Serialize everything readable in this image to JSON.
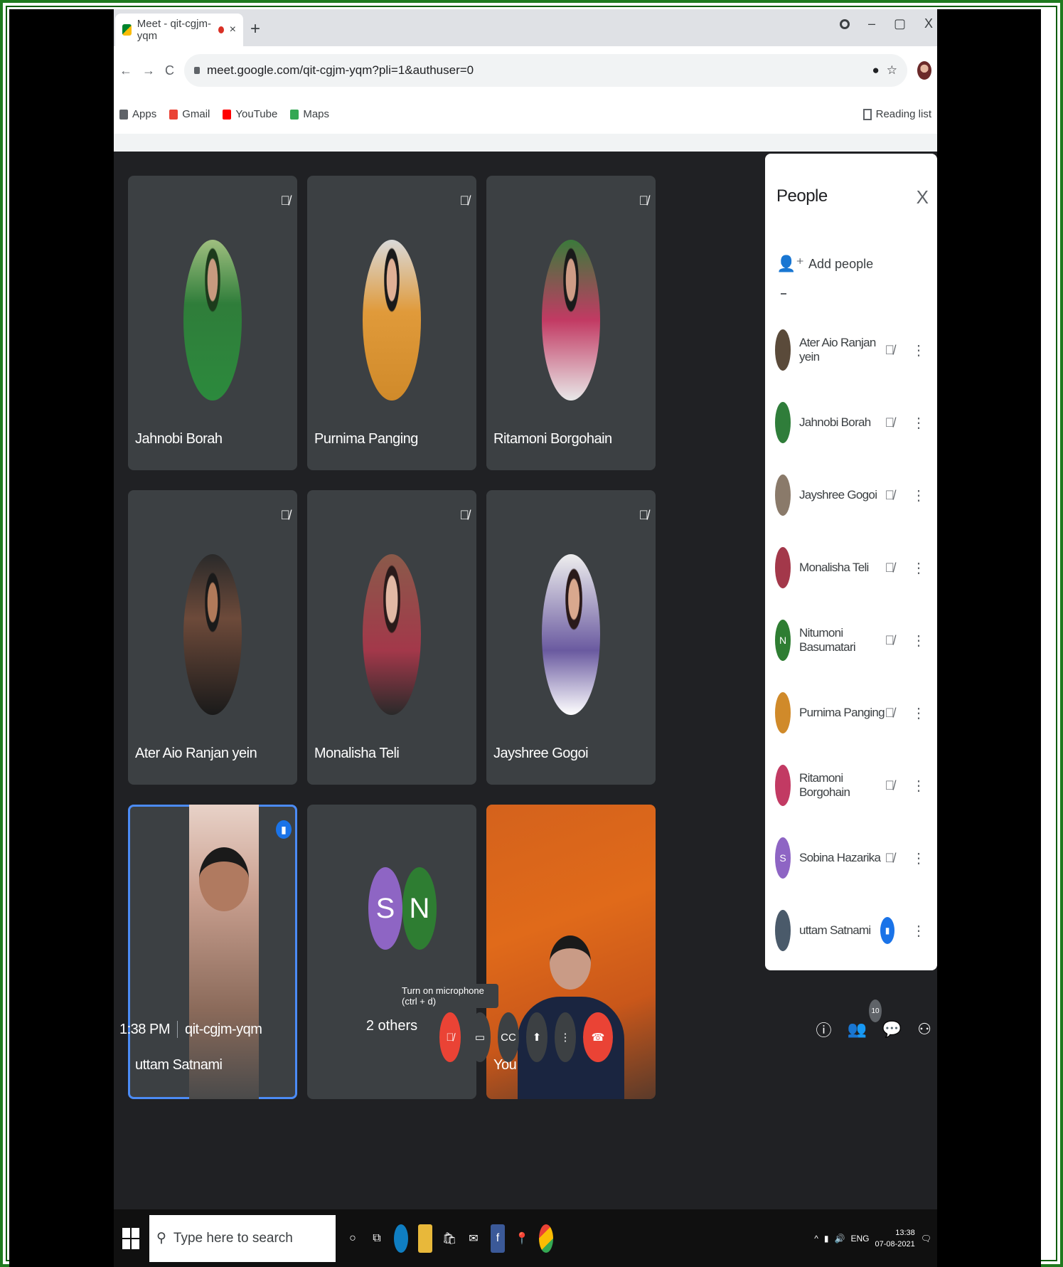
{
  "browser": {
    "tab_title": "Meet - qit-cgjm-yqm",
    "tab_close": "×",
    "new_tab": "+",
    "url": "meet.google.com/qit-cgjm-yqm?pli=1&authuser=0",
    "nav": {
      "back": "←",
      "forward": "→",
      "reload": "C"
    },
    "window_controls": {
      "minimize": "–",
      "maximize": "▢",
      "close": "X"
    },
    "bookmarks": [
      {
        "label": "Apps",
        "color": "#5f6368"
      },
      {
        "label": "Gmail",
        "color": "#ea4335"
      },
      {
        "label": "YouTube",
        "color": "#ff0000"
      },
      {
        "label": "Maps",
        "color": "#34a853"
      }
    ],
    "reading_list": "Reading list"
  },
  "tiles": [
    {
      "name": "Jahnobi Borah",
      "avatar": "av1"
    },
    {
      "name": "Purnima Panging",
      "avatar": "av2"
    },
    {
      "name": "Ritamoni Borgohain",
      "avatar": "av3"
    },
    {
      "name": "Ater Aio Ranjan yein",
      "avatar": "av4"
    },
    {
      "name": "Monalisha Teli",
      "avatar": "av5"
    },
    {
      "name": "Jayshree Gogoi",
      "avatar": "av6"
    }
  ],
  "video_tiles": {
    "uttam": "uttam Satnami",
    "others_label": "2 others",
    "others_initials": [
      "S",
      "N"
    ],
    "self": "You"
  },
  "people_panel": {
    "title": "People",
    "close": "X",
    "add_people": "Add people",
    "participants": [
      {
        "name": "Ater Aio Ranjan yein",
        "initial": "",
        "color": "#5a4a3a",
        "mic": "off"
      },
      {
        "name": "Jahnobi Borah",
        "initial": "",
        "color": "#2f7d3a",
        "mic": "off"
      },
      {
        "name": "Jayshree Gogoi",
        "initial": "",
        "color": "#8a7a6a",
        "mic": "off"
      },
      {
        "name": "Monalisha Teli",
        "initial": "",
        "color": "#a3384a",
        "mic": "off"
      },
      {
        "name": "Nitumoni Basumatari",
        "initial": "N",
        "color": "#2e7d32",
        "mic": "off"
      },
      {
        "name": "Purnima Panging",
        "initial": "",
        "color": "#d08a2a",
        "mic": "off"
      },
      {
        "name": "Ritamoni Borgohain",
        "initial": "",
        "color": "#c23a63",
        "mic": "off"
      },
      {
        "name": "Sobina Hazarika",
        "initial": "S",
        "color": "#8e65c4",
        "mic": "off"
      },
      {
        "name": "uttam Satnami",
        "initial": "",
        "color": "#4a5a6a",
        "mic": "on"
      }
    ]
  },
  "bottom_bar": {
    "time": "1:38 PM",
    "meeting_code": "qit-cgjm-yqm",
    "tooltip": "Turn on microphone (ctrl + d)",
    "participant_count": "10"
  },
  "taskbar": {
    "search_placeholder": "Type here to search",
    "lang": "ENG",
    "time": "13:38",
    "date": "07-08-2021"
  }
}
